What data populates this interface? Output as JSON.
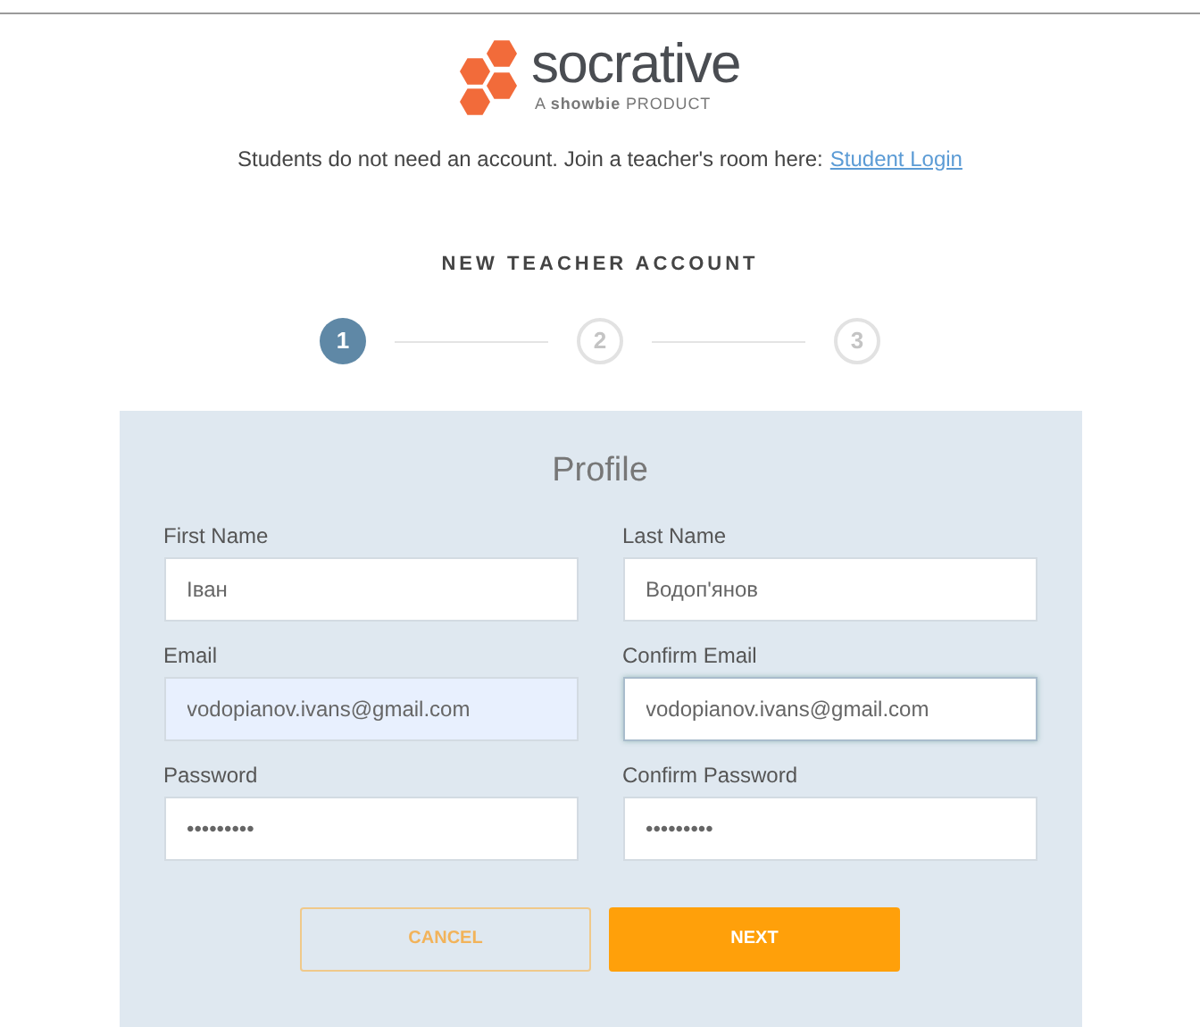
{
  "logo": {
    "name": "socrative",
    "tagline": "A **showbie** PRODUCT"
  },
  "notice": {
    "text": "Students do not need an account. Join a teacher's room here:",
    "link": "Student Login"
  },
  "heading": "NEW TEACHER ACCOUNT",
  "steps": [
    {
      "label": "1",
      "selected": true
    },
    {
      "label": "2",
      "selected": false
    },
    {
      "label": "3",
      "selected": false
    }
  ],
  "form": {
    "title": "Profile",
    "fields": [
      {
        "label": "First Name",
        "value": "Іван",
        "autofilled": false,
        "focused": false
      },
      {
        "label": "Last Name",
        "value": "Водоп'янов",
        "autofilled": false,
        "focused": false
      },
      {
        "label": "Email",
        "value": "vodopianov.ivans@gmail.com",
        "autofilled": true,
        "focused": false
      },
      {
        "label": "Confirm Email",
        "value": "vodopianov.ivans@gmail.com",
        "autofilled": false,
        "focused": true
      },
      {
        "label": "Password",
        "value": "•••••••••",
        "autofilled": false,
        "focused": false
      },
      {
        "label": "Confirm Password",
        "value": "•••••••••",
        "autofilled": false,
        "focused": false
      }
    ],
    "buttons": [
      {
        "label": "CANCEL",
        "kind": "secondary"
      },
      {
        "label": "NEXT",
        "kind": "primary"
      }
    ]
  }
}
